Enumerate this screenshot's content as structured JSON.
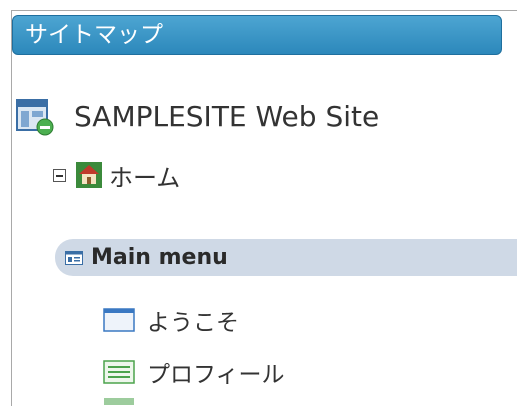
{
  "header": {
    "title": "サイトマップ"
  },
  "site": {
    "label": "SAMPLESITE Web Site",
    "icon": "site-settings-icon"
  },
  "home": {
    "label": "ホーム",
    "icon": "house-icon",
    "toggle_icon": "collapse-minus-icon"
  },
  "menu_group": {
    "label": "Main menu",
    "icon": "menu-list-icon"
  },
  "items": [
    {
      "label": "ようこそ",
      "icon": "blank-page-icon"
    },
    {
      "label": "プロフィール",
      "icon": "text-page-icon"
    }
  ],
  "colors": {
    "header_bg": "#3a97c8",
    "group_bg": "#cfd9e6"
  }
}
